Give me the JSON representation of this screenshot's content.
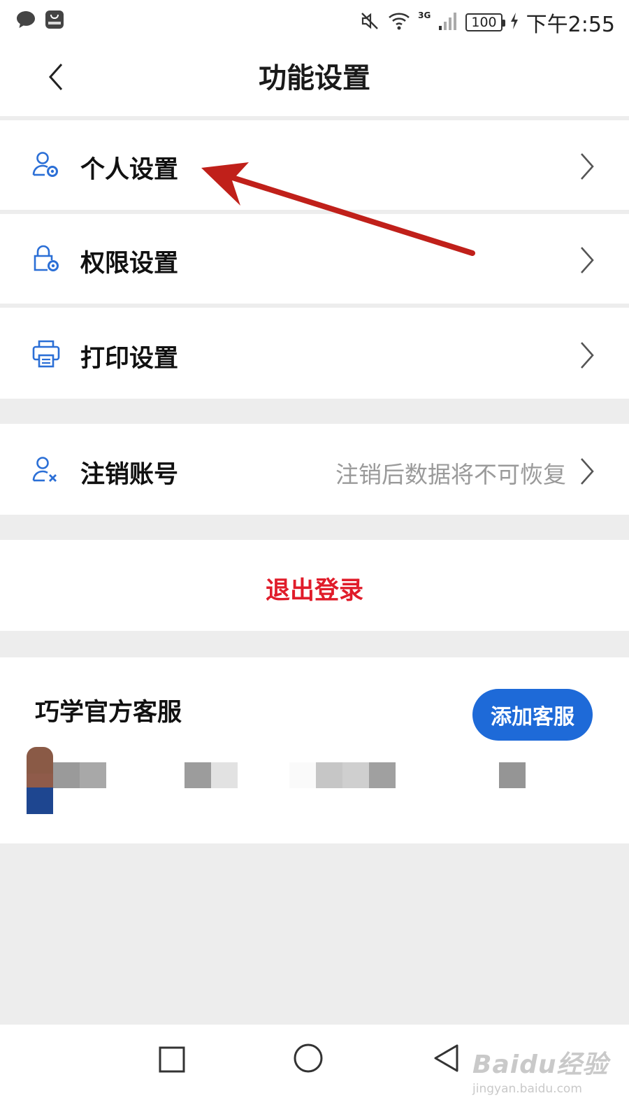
{
  "status_bar": {
    "time": "下午2:55",
    "battery": "100",
    "network": "3G",
    "icons": [
      "chat-bubble-icon",
      "huawei-appgallery-icon",
      "mute-icon",
      "wifi-icon",
      "signal-icon",
      "battery-icon",
      "charging-icon"
    ]
  },
  "header": {
    "title": "功能设置",
    "back_icon": "chevron-left-icon"
  },
  "settings_group": [
    {
      "label": "个人设置",
      "icon": "user-gear-icon"
    },
    {
      "label": "权限设置",
      "icon": "lock-gear-icon"
    },
    {
      "label": "打印设置",
      "icon": "printer-icon"
    }
  ],
  "account": {
    "label": "注销账号",
    "hint": "注销后数据将不可恢复",
    "icon": "user-remove-icon"
  },
  "logout": {
    "label": "退出登录",
    "color": "#e01c2a"
  },
  "service": {
    "title": "巧学官方客服",
    "add_button": "添加客服",
    "button_color": "#1e6ad8"
  },
  "nav_bar": {
    "icons": [
      "recent-apps-icon",
      "home-icon",
      "back-icon"
    ]
  },
  "watermark": {
    "main": "Baidu经验",
    "sub": "jingyan.baidu.com"
  },
  "colors": {
    "accent_blue": "#2b6fd6",
    "annotation_arrow": "#c0201a",
    "background": "#ededed"
  }
}
